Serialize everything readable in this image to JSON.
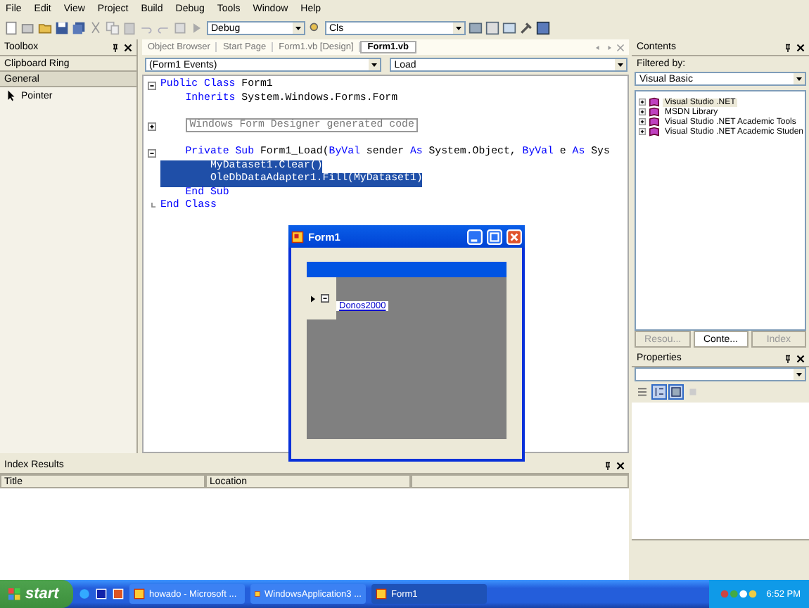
{
  "menu": [
    "File",
    "Edit",
    "View",
    "Project",
    "Build",
    "Debug",
    "Tools",
    "Window",
    "Help"
  ],
  "toolbar": {
    "configuration": "Debug",
    "find": "Cls"
  },
  "toolbox": {
    "title": "Toolbox",
    "sections": [
      {
        "label": "Clipboard Ring",
        "expanded": false
      },
      {
        "label": "General",
        "expanded": true
      }
    ],
    "items": [
      {
        "label": "Pointer"
      }
    ]
  },
  "editor": {
    "tabs": [
      {
        "label": "Object Browser",
        "selected": false
      },
      {
        "label": "Start Page",
        "selected": false
      },
      {
        "label": "Form1.vb [Design]",
        "selected": false
      },
      {
        "label": "Form1.vb",
        "selected": true
      }
    ],
    "class_dropdown": "(Form1 Events)",
    "method_dropdown": "Load",
    "lines": [
      {
        "kind": "collapse",
        "selected": false,
        "blank_before": false,
        "segments": [
          {
            "kind": "kw",
            "text": "Public Class"
          },
          {
            "kind": "txt",
            "text": " Form1"
          }
        ],
        "children": [
          {
            "selected": false,
            "blank_before": false,
            "segments": [
              {
                "kind": "kw",
                "text": "Inherits"
              },
              {
                "kind": "txt",
                "text": " System.Windows.Forms.Form"
              }
            ]
          },
          {
            "kind": "expand",
            "selected": false,
            "blank_before": true,
            "segments": [
              {
                "kind": "region",
                "text": "Windows Form Designer generated code"
              }
            ]
          },
          {
            "kind": "collapse",
            "selected": false,
            "blank_before": true,
            "segments": [
              {
                "kind": "kw",
                "text": "Private Sub"
              },
              {
                "kind": "txt",
                "text": " Form1_Load("
              },
              {
                "kind": "kw",
                "text": "ByVal"
              },
              {
                "kind": "txt",
                "text": " sender "
              },
              {
                "kind": "kw",
                "text": "As"
              },
              {
                "kind": "txt",
                "text": " System.Object, "
              },
              {
                "kind": "kw",
                "text": "ByVal"
              },
              {
                "kind": "txt",
                "text": " e "
              },
              {
                "kind": "kw",
                "text": "As"
              },
              {
                "kind": "txt",
                "text": " Sys"
              }
            ],
            "children": [
              {
                "selected": true,
                "blank_before": false,
                "segments": [
                  {
                    "kind": "txt",
                    "text": "MyDataset1.Clear()"
                  }
                ]
              },
              {
                "selected": true,
                "blank_before": false,
                "segments": [
                  {
                    "kind": "txt",
                    "text": "OleDbDataAdapter1.Fill(MyDataset1)"
                  }
                ]
              }
            ]
          },
          {
            "selected": false,
            "blank_before": false,
            "segments": [
              {
                "kind": "kw",
                "text": "End Sub"
              }
            ]
          }
        ]
      },
      {
        "kind": "end",
        "selected": false,
        "blank_before": false,
        "segments": [
          {
            "kind": "kw",
            "text": "End Class"
          }
        ]
      }
    ]
  },
  "contents": {
    "title": "Contents",
    "filter_label": "Filtered by:",
    "filter": "Visual Basic",
    "tree": [
      {
        "label": "Visual Studio .NET",
        "selected": true
      },
      {
        "label": "MSDN Library",
        "selected": false
      },
      {
        "label": "Visual Studio .NET Academic Tools",
        "selected": false
      },
      {
        "label": "Visual Studio .NET Academic Studen",
        "selected": false
      }
    ],
    "tabs": [
      {
        "label": "Resou...",
        "selected": false
      },
      {
        "label": "Conte...",
        "selected": true
      },
      {
        "label": "Index",
        "selected": false
      }
    ]
  },
  "properties": {
    "title": "Properties"
  },
  "index_results": {
    "title": "Index Results",
    "columns": [
      "Title",
      "Location"
    ]
  },
  "form_window": {
    "title": "Form1",
    "link": "Donos2000"
  },
  "taskbar": {
    "start": "start",
    "tasks": [
      {
        "label": "howado - Microsoft ...",
        "selected": false
      },
      {
        "label": "WindowsApplication3 ...",
        "selected": false
      },
      {
        "label": "Form1",
        "selected": true
      }
    ],
    "clock": "6:52 PM"
  }
}
